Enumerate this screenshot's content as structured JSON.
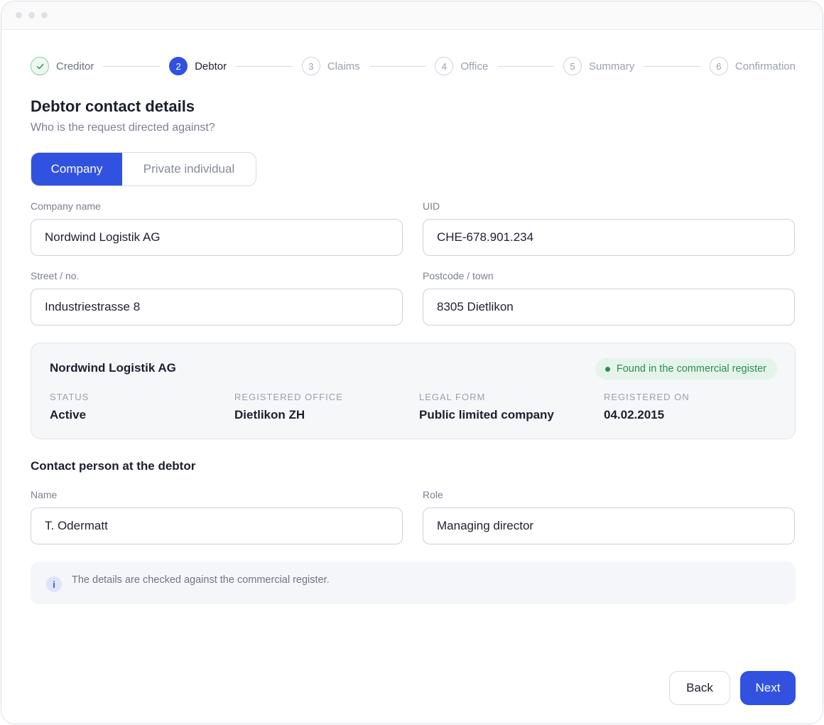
{
  "steps": [
    {
      "number": "✓",
      "label": "Creditor",
      "state": "done"
    },
    {
      "number": "2",
      "label": "Debtor",
      "state": "active"
    },
    {
      "number": "3",
      "label": "Claims",
      "state": "todo"
    },
    {
      "number": "4",
      "label": "Office",
      "state": "todo"
    },
    {
      "number": "5",
      "label": "Summary",
      "state": "todo"
    },
    {
      "number": "6",
      "label": "Confirmation",
      "state": "todo"
    }
  ],
  "page": {
    "title": "Debtor contact details",
    "subtitle": "Who is the request directed against?"
  },
  "debtor_type": {
    "options": [
      "Company",
      "Private individual"
    ],
    "selected": "Company"
  },
  "form": {
    "company_name": {
      "label": "Company name",
      "value": "Nordwind Logistik AG"
    },
    "uid": {
      "label": "UID",
      "value": "CHE-678.901.234"
    },
    "street": {
      "label": "Street / no.",
      "value": "Industriestrasse 8"
    },
    "postcode": {
      "label": "Postcode / town",
      "value": "8305 Dietlikon"
    }
  },
  "register": {
    "company": "Nordwind Logistik AG",
    "badge": "Found in the commercial register",
    "status_label": "STATUS",
    "status_value": "Active",
    "office_label": "REGISTERED OFFICE",
    "office_value": "Dietlikon ZH",
    "form_label": "LEGAL FORM",
    "form_value": "Public limited company",
    "date_label": "REGISTERED ON",
    "date_value": "04.02.2015"
  },
  "contact": {
    "section_title": "Contact person at the debtor",
    "name": {
      "label": "Name",
      "value": "T. Odermatt"
    },
    "role": {
      "label": "Role",
      "value": "Managing director"
    }
  },
  "info": {
    "icon": "i",
    "text": "The details are checked against the commercial register."
  },
  "buttons": {
    "back": "Back",
    "next": "Next"
  },
  "colors": {
    "accent": "#3152e0",
    "success": "#2e8a55"
  }
}
